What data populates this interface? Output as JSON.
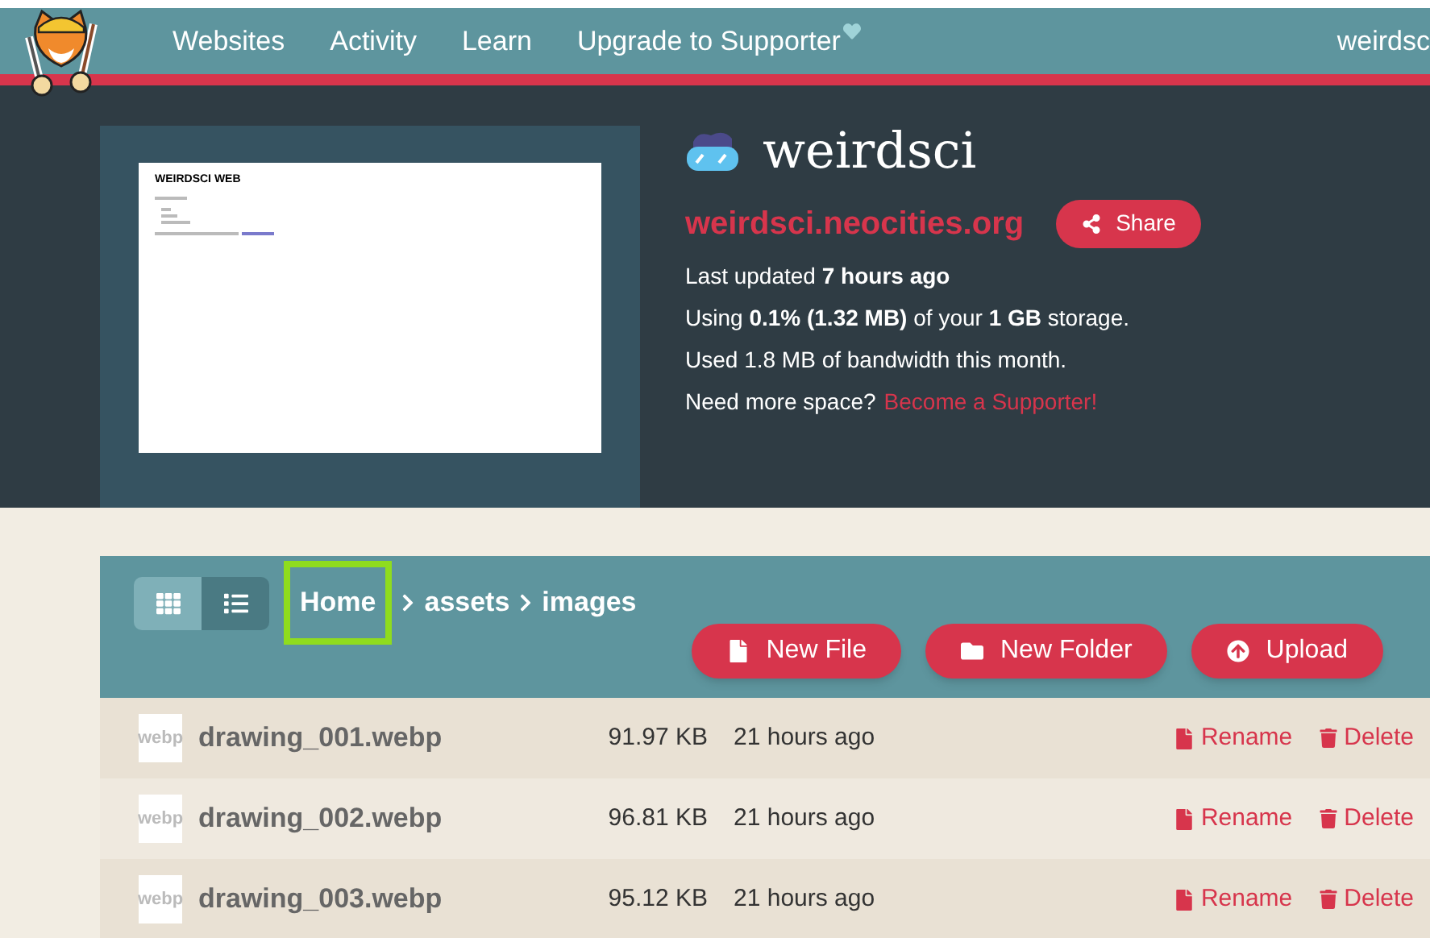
{
  "nav": {
    "items": [
      "Websites",
      "Activity",
      "Learn",
      "Upgrade to Supporter"
    ],
    "user": "weirdsc"
  },
  "site": {
    "preview_title": "WEIRDSCI WEB",
    "name": "weirdsci",
    "domain": "weirdsci.neocities.org",
    "share": "Share",
    "stats": [
      "Last updated **7 hours ago**",
      "Using **0.1% (1.32 MB)** of your **1 GB** storage.",
      "Used 1.8 MB of bandwidth this month."
    ],
    "more_space": "Need more space?",
    "supporter_link": "Become a Supporter!"
  },
  "toolbar": {
    "views": [
      {
        "kind": "grid",
        "selected": false
      },
      {
        "kind": "list",
        "selected": true
      }
    ],
    "breadcrumb": [
      {
        "label": "Home",
        "highlighted": true
      },
      {
        "label": "assets",
        "highlighted": false
      },
      {
        "label": "images",
        "highlighted": false
      }
    ],
    "buttons": [
      {
        "kind": "file",
        "label": "New File"
      },
      {
        "kind": "folder",
        "label": "New Folder"
      },
      {
        "kind": "upload",
        "label": "Upload"
      }
    ]
  },
  "files": [
    {
      "icon_label": "webp",
      "name": "drawing_001.webp",
      "size": "91.97 KB",
      "modified": "21 hours ago",
      "rename": "Rename",
      "delete": "Delete"
    },
    {
      "icon_label": "webp",
      "name": "drawing_002.webp",
      "size": "96.81 KB",
      "modified": "21 hours ago",
      "rename": "Rename",
      "delete": "Delete"
    },
    {
      "icon_label": "webp",
      "name": "drawing_003.webp",
      "size": "95.12 KB",
      "modified": "21 hours ago",
      "rename": "Rename",
      "delete": "Delete"
    }
  ]
}
